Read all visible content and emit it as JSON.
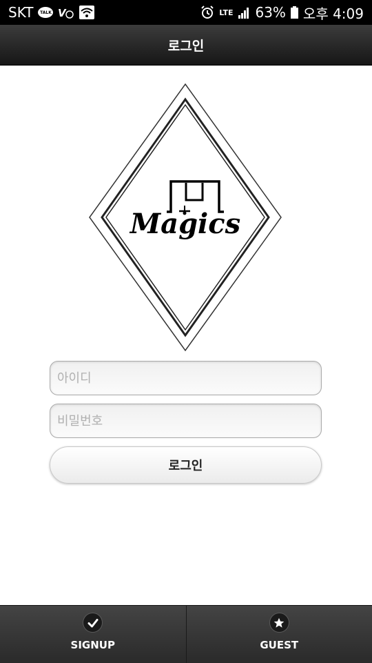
{
  "status_bar": {
    "carrier": "SKT",
    "network": "LTE",
    "battery": "63%",
    "time": "오후 4:09"
  },
  "header": {
    "title": "로그인"
  },
  "logo": {
    "brand": "Magics"
  },
  "form": {
    "id_placeholder": "아이디",
    "id_value": "",
    "password_placeholder": "비밀번호",
    "password_value": "",
    "login_label": "로그인"
  },
  "bottom_nav": {
    "items": [
      {
        "label": "SIGNUP",
        "icon": "check-icon"
      },
      {
        "label": "GUEST",
        "icon": "star-icon"
      }
    ]
  }
}
